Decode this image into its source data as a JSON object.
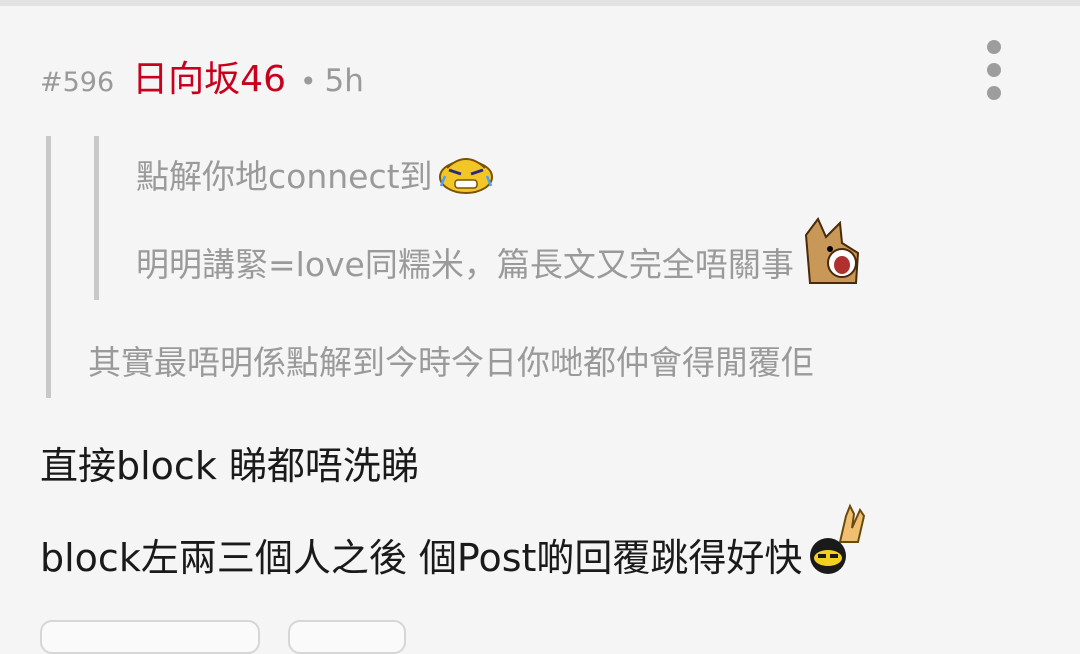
{
  "post": {
    "number": "#596",
    "username": "日向坂46",
    "separator": "•",
    "time": "5h"
  },
  "menu_icon": "more-vertical-icon",
  "quote": {
    "nested_line1": "點解你地connect到",
    "nested_line1_emoji": "crying-face-icon",
    "nested_line2": "明明講緊=love同糯米，篇長文又完全唔關事",
    "nested_line2_emoji": "shocked-dog-icon",
    "outer_line": "其實最唔明係點解到今時今日你哋都仲會得閒覆佢"
  },
  "body": {
    "line1": "直接block 睇都唔洗睇",
    "line2": "block左兩三個人之後 個Post啲回覆跳得好快",
    "line2_emoji": "rock-hand-icon"
  },
  "colors": {
    "username": "#c8001e",
    "meta_gray": "#9a9a9a",
    "quote_bar": "#c8c8c8",
    "background": "#f5f5f5"
  }
}
